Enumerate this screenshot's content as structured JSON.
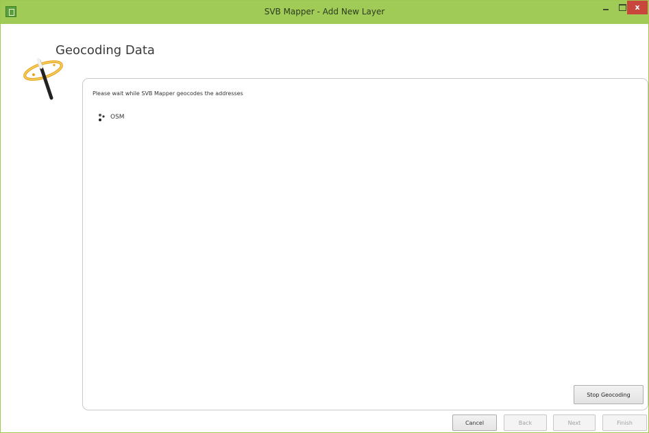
{
  "window": {
    "title": "SVB Mapper - Add New Layer",
    "controls": {
      "minimize": "",
      "maximize": "",
      "close": "x"
    },
    "titlebar_color": "#9fcb56",
    "close_color": "#c9463d"
  },
  "page": {
    "title": "Geocoding Data",
    "logo_icon": "magic-wand-icon"
  },
  "panel": {
    "status_text": "Please wait while SVB Mapper geocodes the addresses",
    "sources": [
      {
        "icon": "spinner-icon",
        "label": "OSM"
      }
    ],
    "stop_button": "Stop Geocoding"
  },
  "footer": {
    "cancel": "Cancel",
    "back": "Back",
    "next": "Next",
    "finish": "Finish"
  }
}
